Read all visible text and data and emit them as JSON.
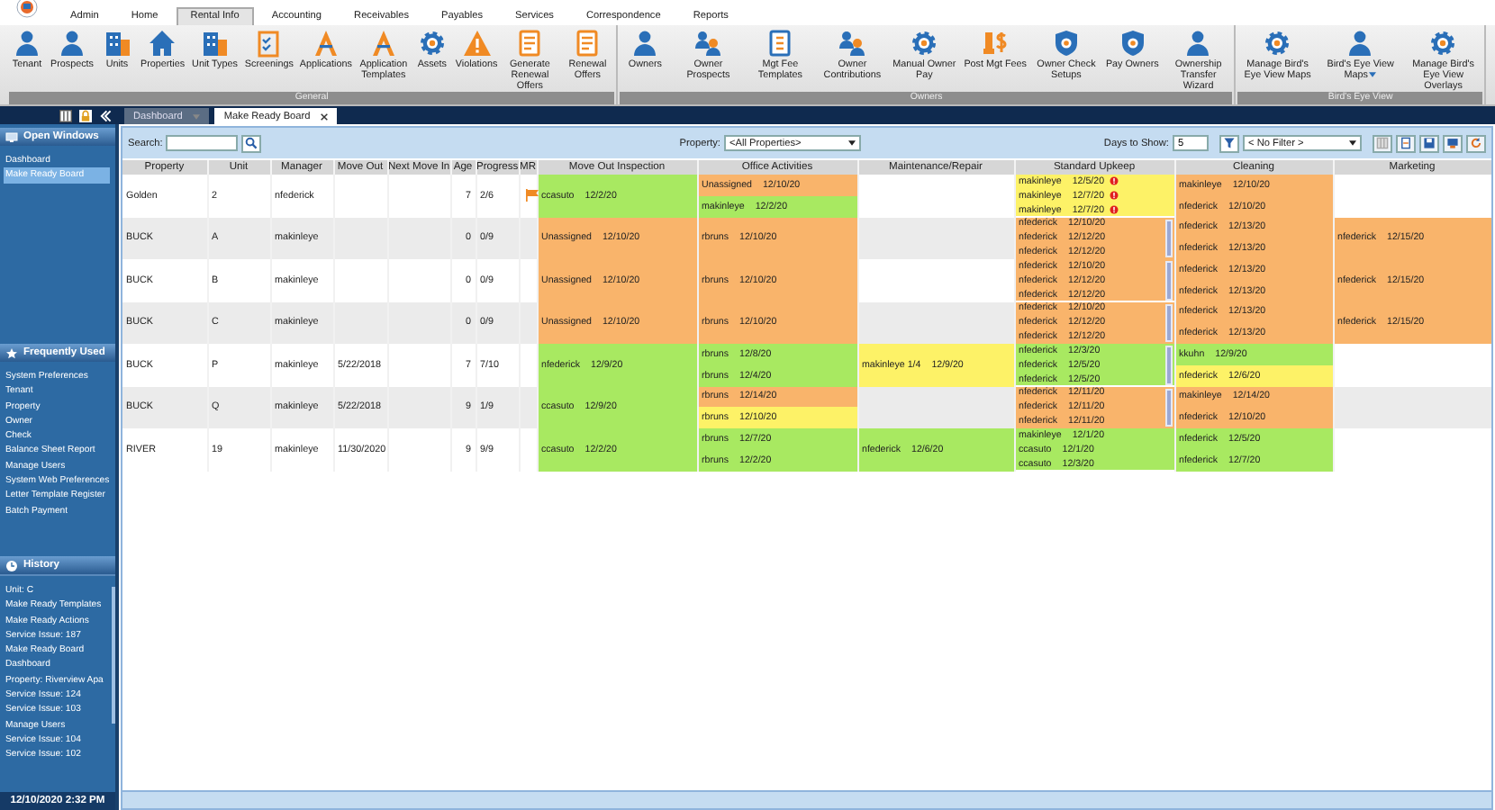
{
  "menu": [
    {
      "label": "Admin",
      "selected": false
    },
    {
      "label": "Home",
      "selected": false
    },
    {
      "label": "Rental Info",
      "selected": true
    },
    {
      "label": "Accounting",
      "selected": false
    },
    {
      "label": "Receivables",
      "selected": false
    },
    {
      "label": "Payables",
      "selected": false
    },
    {
      "label": "Services",
      "selected": false
    },
    {
      "label": "Correspondence",
      "selected": false
    },
    {
      "label": "Reports",
      "selected": false
    }
  ],
  "ribbon": [
    {
      "label": "General",
      "items": [
        {
          "label": "Tenant"
        },
        {
          "label": "Prospects"
        },
        {
          "label": "Units"
        },
        {
          "label": "Properties"
        },
        {
          "label": "Unit Types"
        },
        {
          "label": "Screenings"
        },
        {
          "label": "Applications"
        },
        {
          "label": "Application Templates"
        },
        {
          "label": "Assets"
        },
        {
          "label": "Violations"
        },
        {
          "label": "Generate Renewal Offers"
        },
        {
          "label": "Renewal Offers"
        }
      ]
    },
    {
      "label": "Owners",
      "items": [
        {
          "label": "Owners"
        },
        {
          "label": "Owner Prospects"
        },
        {
          "label": "Mgt Fee Templates"
        },
        {
          "label": "Owner Contributions"
        },
        {
          "label": "Manual Owner Pay"
        },
        {
          "label": "Post Mgt Fees"
        },
        {
          "label": "Owner Check Setups"
        },
        {
          "label": "Pay Owners"
        },
        {
          "label": "Ownership Transfer Wizard"
        }
      ]
    },
    {
      "label": "Bird's Eye View",
      "items": [
        {
          "label": "Manage Bird's Eye View Maps"
        },
        {
          "label": "Bird's Eye View Maps",
          "dropdown": true
        },
        {
          "label": "Manage Bird's Eye View Overlays"
        }
      ]
    }
  ],
  "doc_tabs": [
    {
      "label": "Dashboard",
      "kind": "dropdown",
      "selected": false
    },
    {
      "label": "Make Ready Board",
      "kind": "closable",
      "selected": true
    }
  ],
  "sidebar": {
    "open_windows": {
      "title": "Open Windows",
      "items": [
        {
          "label": "Dashboard",
          "selected": false
        },
        {
          "label": "Make Ready Board",
          "selected": true
        }
      ]
    },
    "frequently_used": {
      "title": "Frequently Used",
      "items": [
        "System Preferences",
        "Tenant",
        "Property",
        "Owner",
        "Check",
        "Balance Sheet Report",
        "Manage Users",
        "System Web Preferences",
        "Letter Template Register",
        "Batch Payment"
      ]
    },
    "history": {
      "title": "History",
      "items": [
        "Unit: C",
        "Make Ready Templates",
        "Make Ready Actions",
        "Service Issue: 187",
        "Make Ready Board",
        "Dashboard",
        "Property: Riverview Apa",
        "Service Issue: 124",
        "Service Issue: 103",
        "Manage Users",
        "Service Issue: 104",
        "Service Issue: 102"
      ]
    },
    "clock": "12/10/2020 2:32 PM"
  },
  "toolbar": {
    "search_label": "Search:",
    "property_label": "Property:",
    "property_value": "<All Properties>",
    "days_label": "Days to Show:",
    "days_value": "5",
    "filter_value": "< No Filter >"
  },
  "table": {
    "columns": [
      "Property",
      "Unit",
      "Manager",
      "Move Out",
      "Next Move In",
      "Age",
      "Progress",
      "MR",
      "Move Out Inspection",
      "Office Activities",
      "Maintenance/Repair",
      "Standard Upkeep",
      "Cleaning",
      "Marketing"
    ],
    "rows": [
      {
        "property": "Golden",
        "unit": "2",
        "manager": "nfederick",
        "age": "7",
        "progress": "2/6",
        "flag": true,
        "move_out_inspection": {
          "entries": [
            {
              "assignee": "ccasuto",
              "date": "12/2/20",
              "color": "#a8e961"
            }
          ]
        },
        "office_activities": {
          "entries": [
            {
              "assignee": "Unassigned",
              "date": "12/10/20",
              "color": "#f9b46b"
            },
            {
              "assignee": "makinleye",
              "date": "12/2/20",
              "color": "#a8e961"
            }
          ]
        },
        "standard_upkeep": {
          "entries": [
            {
              "assignee": "makinleye",
              "date": "12/5/20",
              "color": "#fdf267",
              "alert": true
            },
            {
              "assignee": "makinleye",
              "date": "12/7/20",
              "color": "#fdf267",
              "alert": true
            },
            {
              "assignee": "makinleye",
              "date": "12/7/20",
              "color": "#fdf267",
              "alert": true
            }
          ]
        },
        "cleaning": {
          "entries": [
            {
              "assignee": "makinleye",
              "date": "12/10/20",
              "color": "#f9b46b"
            },
            {
              "assignee": "nfederick",
              "date": "12/10/20",
              "color": "#f9b46b"
            }
          ]
        }
      },
      {
        "property": "BUCK",
        "unit": "A",
        "manager": "makinleye",
        "age": "0",
        "progress": "0/9",
        "flag": false,
        "move_out_inspection": {
          "entries": [
            {
              "assignee": "Unassigned",
              "date": "12/10/20",
              "color": "#f9b46b"
            }
          ]
        },
        "office_activities": {
          "entries": [
            {
              "assignee": "rbruns",
              "date": "12/10/20",
              "color": "#f9b46b"
            }
          ]
        },
        "standard_upkeep": {
          "scrollbar": true,
          "entries": [
            {
              "assignee": "nfederick",
              "date": "12/10/20",
              "color": "#f9b46b"
            },
            {
              "assignee": "nfederick",
              "date": "12/12/20",
              "color": "#f9b46b"
            },
            {
              "assignee": "nfederick",
              "date": "12/12/20",
              "color": "#f9b46b"
            }
          ]
        },
        "cleaning": {
          "entries": [
            {
              "assignee": "nfederick",
              "date": "12/13/20",
              "color": "#f9b46b"
            },
            {
              "assignee": "nfederick",
              "date": "12/13/20",
              "color": "#f9b46b"
            }
          ]
        },
        "marketing": {
          "entries": [
            {
              "assignee": "nfederick",
              "date": "12/15/20",
              "color": "#f9b46b"
            }
          ]
        }
      },
      {
        "property": "BUCK",
        "unit": "B",
        "manager": "makinleye",
        "age": "0",
        "progress": "0/9",
        "flag": false,
        "move_out_inspection": {
          "entries": [
            {
              "assignee": "Unassigned",
              "date": "12/10/20",
              "color": "#f9b46b"
            }
          ]
        },
        "office_activities": {
          "entries": [
            {
              "assignee": "rbruns",
              "date": "12/10/20",
              "color": "#f9b46b"
            }
          ]
        },
        "standard_upkeep": {
          "scrollbar": true,
          "entries": [
            {
              "assignee": "nfederick",
              "date": "12/10/20",
              "color": "#f9b46b"
            },
            {
              "assignee": "nfederick",
              "date": "12/12/20",
              "color": "#f9b46b"
            },
            {
              "assignee": "nfederick",
              "date": "12/12/20",
              "color": "#f9b46b"
            }
          ]
        },
        "cleaning": {
          "entries": [
            {
              "assignee": "nfederick",
              "date": "12/13/20",
              "color": "#f9b46b"
            },
            {
              "assignee": "nfederick",
              "date": "12/13/20",
              "color": "#f9b46b"
            }
          ]
        },
        "marketing": {
          "entries": [
            {
              "assignee": "nfederick",
              "date": "12/15/20",
              "color": "#f9b46b"
            }
          ]
        }
      },
      {
        "property": "BUCK",
        "unit": "C",
        "manager": "makinleye",
        "age": "0",
        "progress": "0/9",
        "flag": false,
        "move_out_inspection": {
          "entries": [
            {
              "assignee": "Unassigned",
              "date": "12/10/20",
              "color": "#f9b46b"
            }
          ]
        },
        "office_activities": {
          "entries": [
            {
              "assignee": "rbruns",
              "date": "12/10/20",
              "color": "#f9b46b"
            }
          ]
        },
        "standard_upkeep": {
          "scrollbar": true,
          "entries": [
            {
              "assignee": "nfederick",
              "date": "12/10/20",
              "color": "#f9b46b"
            },
            {
              "assignee": "nfederick",
              "date": "12/12/20",
              "color": "#f9b46b"
            },
            {
              "assignee": "nfederick",
              "date": "12/12/20",
              "color": "#f9b46b"
            }
          ]
        },
        "cleaning": {
          "entries": [
            {
              "assignee": "nfederick",
              "date": "12/13/20",
              "color": "#f9b46b"
            },
            {
              "assignee": "nfederick",
              "date": "12/13/20",
              "color": "#f9b46b"
            }
          ]
        },
        "marketing": {
          "entries": [
            {
              "assignee": "nfederick",
              "date": "12/15/20",
              "color": "#f9b46b"
            }
          ]
        }
      },
      {
        "property": "BUCK",
        "unit": "P",
        "manager": "makinleye",
        "move_out": "5/22/2018",
        "age": "7",
        "progress": "7/10",
        "flag": false,
        "move_out_inspection": {
          "entries": [
            {
              "assignee": "nfederick",
              "date": "12/9/20",
              "color": "#a8e961"
            }
          ]
        },
        "office_activities": {
          "entries": [
            {
              "assignee": "rbruns",
              "date": "12/8/20",
              "color": "#a8e961"
            },
            {
              "assignee": "rbruns",
              "date": "12/4/20",
              "color": "#a8e961"
            }
          ]
        },
        "maintenance_repair": {
          "entries": [
            {
              "assignee": "makinleye 1/4",
              "date": "12/9/20",
              "color": "#fdf267"
            }
          ]
        },
        "standard_upkeep": {
          "scrollbar": true,
          "entries": [
            {
              "assignee": "nfederick",
              "date": "12/3/20",
              "color": "#a8e961"
            },
            {
              "assignee": "nfederick",
              "date": "12/5/20",
              "color": "#a8e961"
            },
            {
              "assignee": "nfederick",
              "date": "12/5/20",
              "color": "#a8e961"
            }
          ]
        },
        "cleaning": {
          "entries": [
            {
              "assignee": "kkuhn",
              "date": "12/9/20",
              "color": "#a8e961"
            },
            {
              "assignee": "nfederick",
              "date": "12/6/20",
              "color": "#fdf267"
            }
          ]
        }
      },
      {
        "property": "BUCK",
        "unit": "Q",
        "manager": "makinleye",
        "move_out": "5/22/2018",
        "age": "9",
        "progress": "1/9",
        "flag": false,
        "move_out_inspection": {
          "entries": [
            {
              "assignee": "ccasuto",
              "date": "12/9/20",
              "color": "#a8e961"
            }
          ]
        },
        "office_activities": {
          "entries": [
            {
              "assignee": "rbruns",
              "date": "12/14/20",
              "color": "#f9b46b"
            },
            {
              "assignee": "rbruns",
              "date": "12/10/20",
              "color": "#fdf267"
            }
          ]
        },
        "standard_upkeep": {
          "scrollbar": true,
          "entries": [
            {
              "assignee": "nfederick",
              "date": "12/11/20",
              "color": "#f9b46b"
            },
            {
              "assignee": "nfederick",
              "date": "12/11/20",
              "color": "#f9b46b"
            },
            {
              "assignee": "nfederick",
              "date": "12/11/20",
              "color": "#f9b46b"
            }
          ]
        },
        "cleaning": {
          "entries": [
            {
              "assignee": "makinleye",
              "date": "12/14/20",
              "color": "#f9b46b"
            },
            {
              "assignee": "nfederick",
              "date": "12/10/20",
              "color": "#f9b46b"
            }
          ]
        }
      },
      {
        "property": "RIVER",
        "unit": "19",
        "manager": "makinleye",
        "move_out": "11/30/2020",
        "age": "9",
        "progress": "9/9",
        "flag": false,
        "move_out_inspection": {
          "entries": [
            {
              "assignee": "ccasuto",
              "date": "12/2/20",
              "color": "#a8e961"
            }
          ]
        },
        "office_activities": {
          "entries": [
            {
              "assignee": "rbruns",
              "date": "12/7/20",
              "color": "#a8e961"
            },
            {
              "assignee": "rbruns",
              "date": "12/2/20",
              "color": "#a8e961"
            }
          ]
        },
        "maintenance_repair": {
          "entries": [
            {
              "assignee": "nfederick",
              "date": "12/6/20",
              "color": "#a8e961"
            }
          ]
        },
        "standard_upkeep": {
          "entries": [
            {
              "assignee": "makinleye",
              "date": "12/1/20",
              "color": "#a8e961"
            },
            {
              "assignee": "ccasuto",
              "date": "12/1/20",
              "color": "#a8e961"
            },
            {
              "assignee": "ccasuto",
              "date": "12/3/20",
              "color": "#a8e961"
            }
          ]
        },
        "cleaning": {
          "entries": [
            {
              "assignee": "nfederick",
              "date": "12/5/20",
              "color": "#a8e961"
            },
            {
              "assignee": "nfederick",
              "date": "12/7/20",
              "color": "#a8e961"
            }
          ]
        }
      }
    ]
  }
}
